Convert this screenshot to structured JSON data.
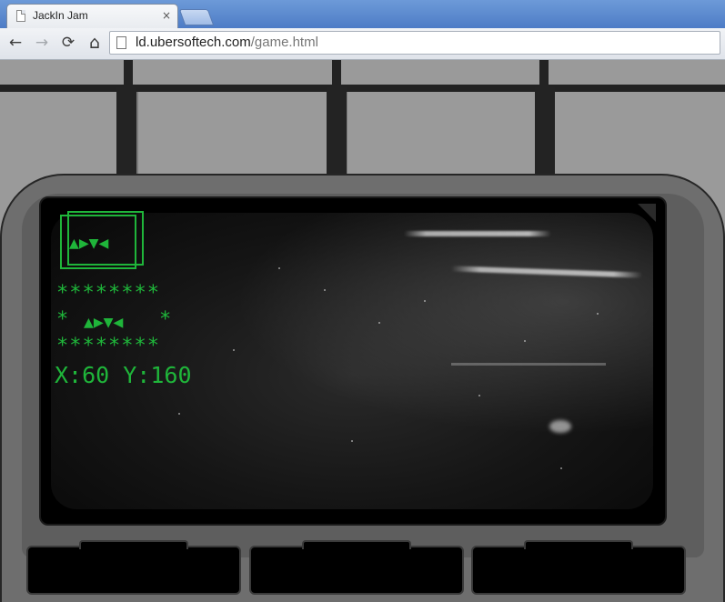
{
  "browser": {
    "tab_title": "JackIn Jam",
    "tab_close": "×",
    "back": "←",
    "forward": "→",
    "reload": "⟳",
    "home": "⌂",
    "url_host": "ld.ubersoftech.com",
    "url_path": "/game.html"
  },
  "hud": {
    "ship_icon_boxed": "▲▶▼◀",
    "stars_top": "********",
    "ship_row_left": "*",
    "ship_icon": "▲▶▼◀",
    "ship_row_right": "*",
    "stars_bottom": "********",
    "coordinates": "X:60 Y:160",
    "color": "#1fb53a"
  },
  "colors": {
    "console": "#6e6e6e",
    "room_wall": "#9a9a9a",
    "tabstrip": "#4d7cc6"
  }
}
